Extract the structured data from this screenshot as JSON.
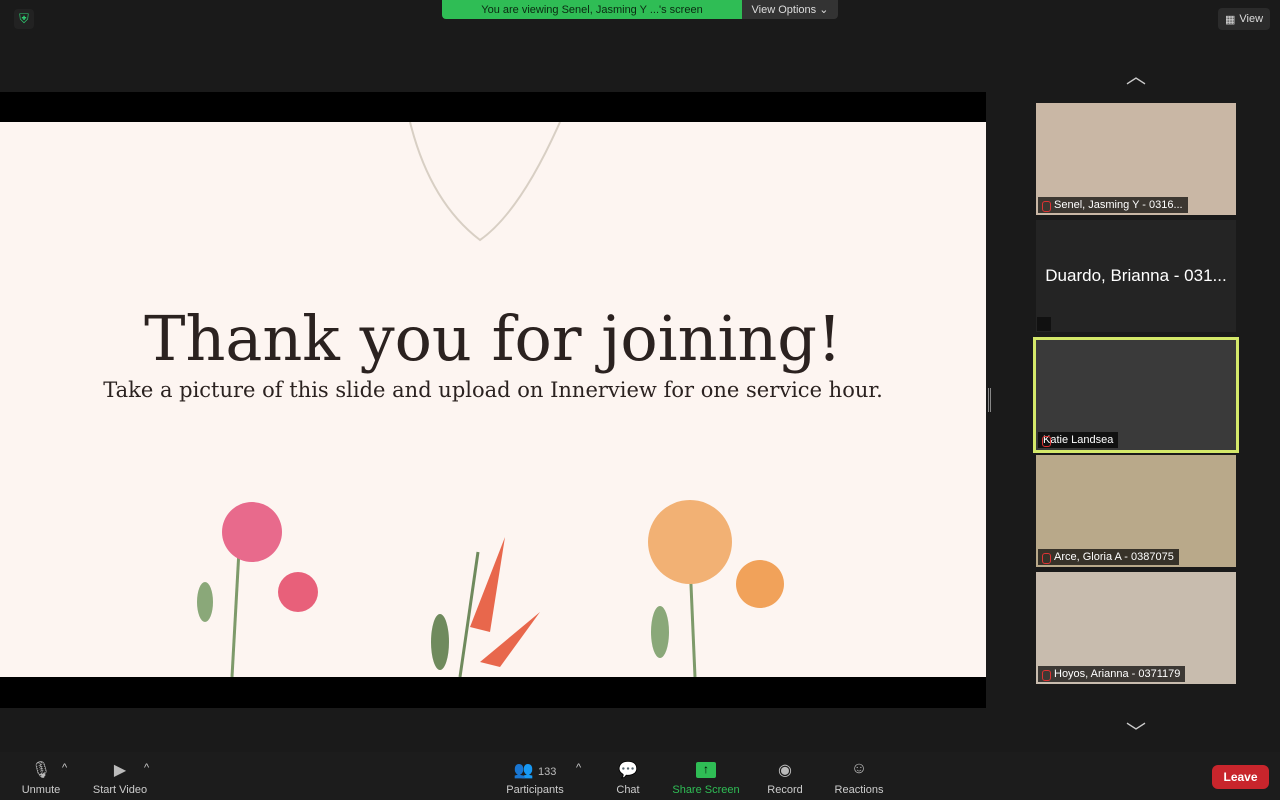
{
  "banner": {
    "text": "You are viewing Senel, Jasming Y ...'s screen",
    "view_options": "View Options ⌄"
  },
  "view_button": "View",
  "slide": {
    "title": "Thank you for joining!",
    "subtitle": "Take a picture of this slide and upload on Innerview for one service hour."
  },
  "participants": [
    {
      "name": "Senel, Jasming Y - 0316...",
      "bg": "#c9b7a5"
    },
    {
      "name": "Duardo, Brianna - 031...",
      "bg": "#242424"
    },
    {
      "name": "Katie Landsea",
      "bg": "#3a3a3a"
    },
    {
      "name": "Arce, Gloria A - 0387075",
      "bg": "#b9a98a"
    },
    {
      "name": "Hoyos, Arianna - 0371179",
      "bg": "#c8bcae"
    }
  ],
  "toolbar": {
    "unmute": "Unmute",
    "start_video": "Start Video",
    "participants": "Participants",
    "participant_count": "133",
    "chat": "Chat",
    "share_screen": "Share Screen",
    "record": "Record",
    "reactions": "Reactions",
    "leave": "Leave"
  },
  "colors": {
    "active_speaker": "#d4e86a",
    "share_green": "#2fbd55",
    "leave_red": "#c8252c"
  }
}
